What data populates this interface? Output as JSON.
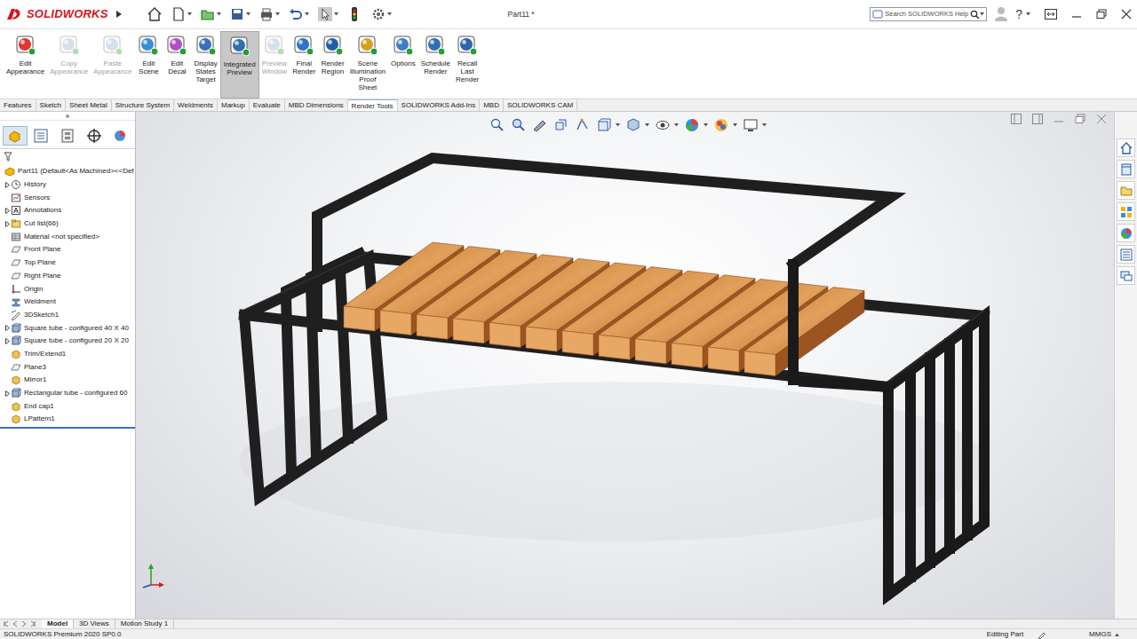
{
  "app": {
    "logo": "SOLIDWORKS",
    "title": "Part11 *",
    "search_placeholder": "Search SOLIDWORKS Help",
    "help": "?"
  },
  "ribbon": [
    {
      "label": "Edit Appearance",
      "disabled": false,
      "selected": false
    },
    {
      "label": "Copy Appearance",
      "disabled": true,
      "selected": false
    },
    {
      "label": "Paste Appearance",
      "disabled": true,
      "selected": false
    },
    {
      "label": "Edit Scene",
      "disabled": false,
      "selected": false
    },
    {
      "label": "Edit Decal",
      "disabled": false,
      "selected": false
    },
    {
      "label": "Display States Target",
      "disabled": false,
      "selected": false
    },
    {
      "label": "Integrated Preview",
      "disabled": false,
      "selected": true
    },
    {
      "label": "Preview Window",
      "disabled": true,
      "selected": false
    },
    {
      "label": "Final Render",
      "disabled": false,
      "selected": false
    },
    {
      "label": "Render Region",
      "disabled": false,
      "selected": false
    },
    {
      "label": "Scene Illumination Proof Sheet",
      "disabled": false,
      "selected": false
    },
    {
      "label": "Options",
      "disabled": false,
      "selected": false
    },
    {
      "label": "Schedule Render",
      "disabled": false,
      "selected": false
    },
    {
      "label": "Recall Last Render",
      "disabled": false,
      "selected": false
    }
  ],
  "tabs": [
    {
      "label": "Features",
      "selected": false
    },
    {
      "label": "Sketch",
      "selected": false
    },
    {
      "label": "Sheet Metal",
      "selected": false
    },
    {
      "label": "Structure System",
      "selected": false
    },
    {
      "label": "Weldments",
      "selected": false
    },
    {
      "label": "Markup",
      "selected": false
    },
    {
      "label": "Evaluate",
      "selected": false
    },
    {
      "label": "MBD Dimensions",
      "selected": false
    },
    {
      "label": "Render Tools",
      "selected": true
    },
    {
      "label": "SOLIDWORKS Add-Ins",
      "selected": false
    },
    {
      "label": "MBD",
      "selected": false
    },
    {
      "label": "SOLIDWORKS CAM",
      "selected": false
    }
  ],
  "tree": {
    "root": "Part11  (Default<As Machined><<Def",
    "items": [
      {
        "label": "History",
        "kind": "history",
        "expandable": true
      },
      {
        "label": "Sensors",
        "kind": "sensor",
        "expandable": false
      },
      {
        "label": "Annotations",
        "kind": "annotation",
        "expandable": true
      },
      {
        "label": "Cut list(66)",
        "kind": "cutlist",
        "expandable": true
      },
      {
        "label": "Material <not specified>",
        "kind": "material",
        "expandable": false
      },
      {
        "label": "Front Plane",
        "kind": "plane",
        "expandable": false
      },
      {
        "label": "Top Plane",
        "kind": "plane",
        "expandable": false
      },
      {
        "label": "Right Plane",
        "kind": "plane",
        "expandable": false
      },
      {
        "label": "Origin",
        "kind": "origin",
        "expandable": false
      },
      {
        "label": "Weldment",
        "kind": "weldment",
        "expandable": false
      },
      {
        "label": "3DSketch1",
        "kind": "sketch",
        "expandable": false
      },
      {
        "label": "Square tube - configured 40 X 40",
        "kind": "member",
        "expandable": true
      },
      {
        "label": "Square tube - configured 20 X 20",
        "kind": "member",
        "expandable": true
      },
      {
        "label": "Trim/Extend1",
        "kind": "feature",
        "expandable": false
      },
      {
        "label": "Plane3",
        "kind": "plane",
        "expandable": false
      },
      {
        "label": "Mirror1",
        "kind": "feature",
        "expandable": false
      },
      {
        "label": "Rectangular tube - configured 60",
        "kind": "member",
        "expandable": true
      },
      {
        "label": "End cap1",
        "kind": "feature",
        "expandable": false
      },
      {
        "label": "LPattern1",
        "kind": "feature",
        "expandable": false
      }
    ]
  },
  "bottom_tabs": [
    {
      "label": "Model",
      "selected": true
    },
    {
      "label": "3D Views",
      "selected": false
    },
    {
      "label": "Motion Study 1",
      "selected": false
    }
  ],
  "status_bar": {
    "product": "SOLIDWORKS Premium 2020 SP0.0",
    "mode": "Editing Part",
    "units": "MMGS"
  }
}
